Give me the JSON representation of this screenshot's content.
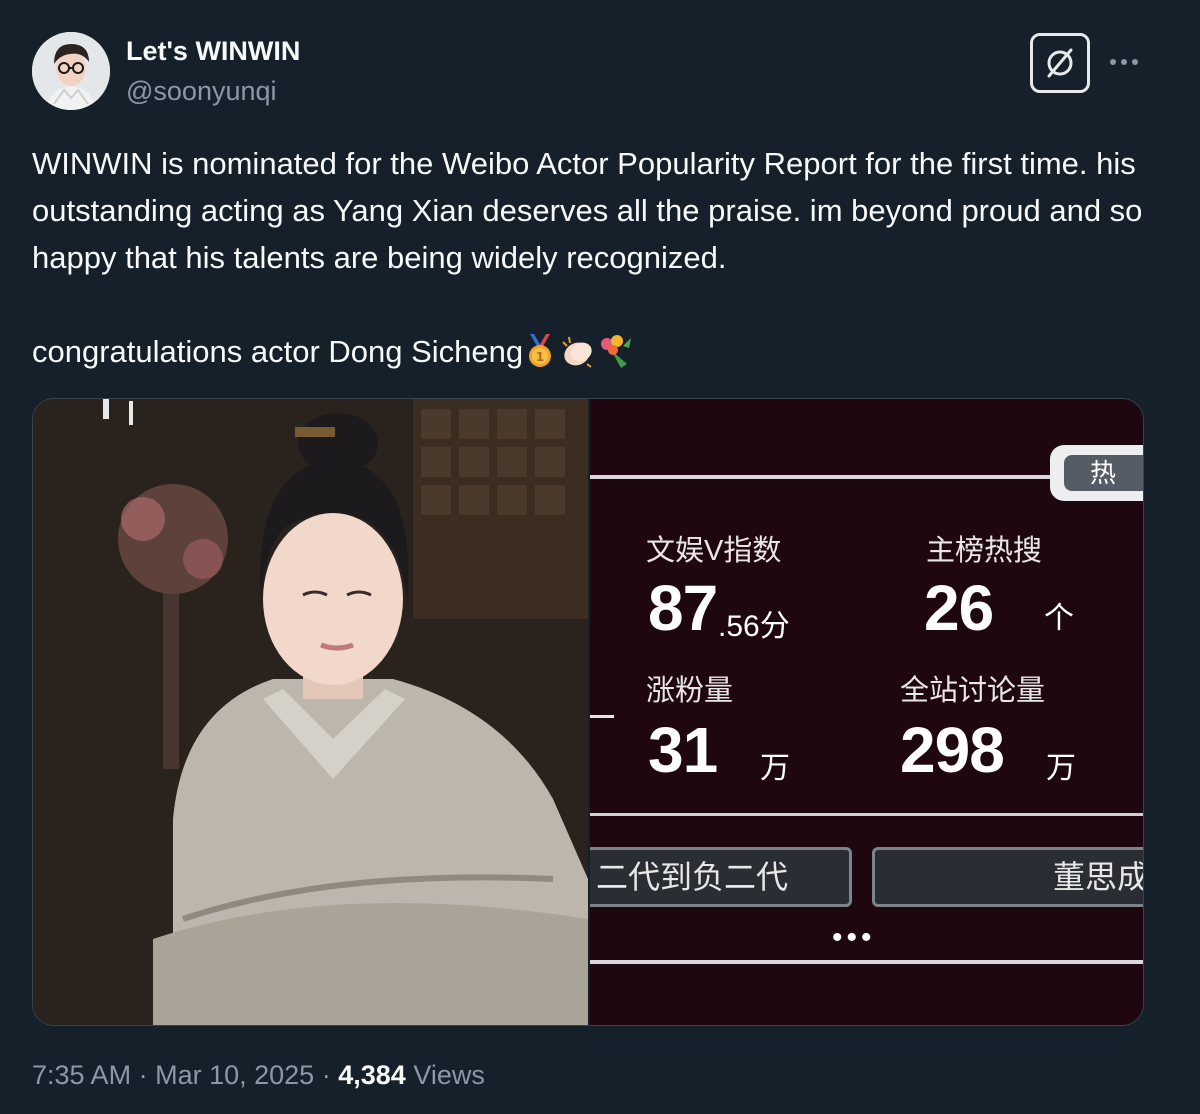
{
  "author": {
    "display_name": "Let's WINWIN",
    "handle": "@soonyunqi"
  },
  "tweet": {
    "paragraph1": "WINWIN is nominated for the Weibo Actor Popularity Report for the first time. his outstanding acting as Yang Xian deserves all the praise. im beyond proud and so happy that his talents are being widely recognized.",
    "paragraph2": "congratulations actor Dong Sicheng",
    "emojis": [
      "medal-icon",
      "clapping-hands-icon",
      "bouquet-icon"
    ]
  },
  "media": {
    "stats_card": {
      "tab_label": "热",
      "stats": [
        {
          "label": "文娱V指数",
          "value": "87",
          "fraction": ".56分"
        },
        {
          "label": "主榜热搜",
          "value": "26",
          "unit": "个"
        },
        {
          "label": "涨粉量",
          "value": "31",
          "unit": "万"
        },
        {
          "label": "全站讨论量",
          "value": "298",
          "unit": "万"
        }
      ],
      "pill_left": "二代到负二代",
      "pill_right": "董思成",
      "more_dots": "•••"
    }
  },
  "meta": {
    "time": "7:35 AM",
    "separator": "·",
    "date": "Mar 10, 2025",
    "views_count": "4,384",
    "views_label": "Views"
  },
  "colors": {
    "background": "#15202b",
    "text_primary": "#f7f9f9",
    "text_secondary": "#8b98a5",
    "card_background": "#1f0710"
  }
}
